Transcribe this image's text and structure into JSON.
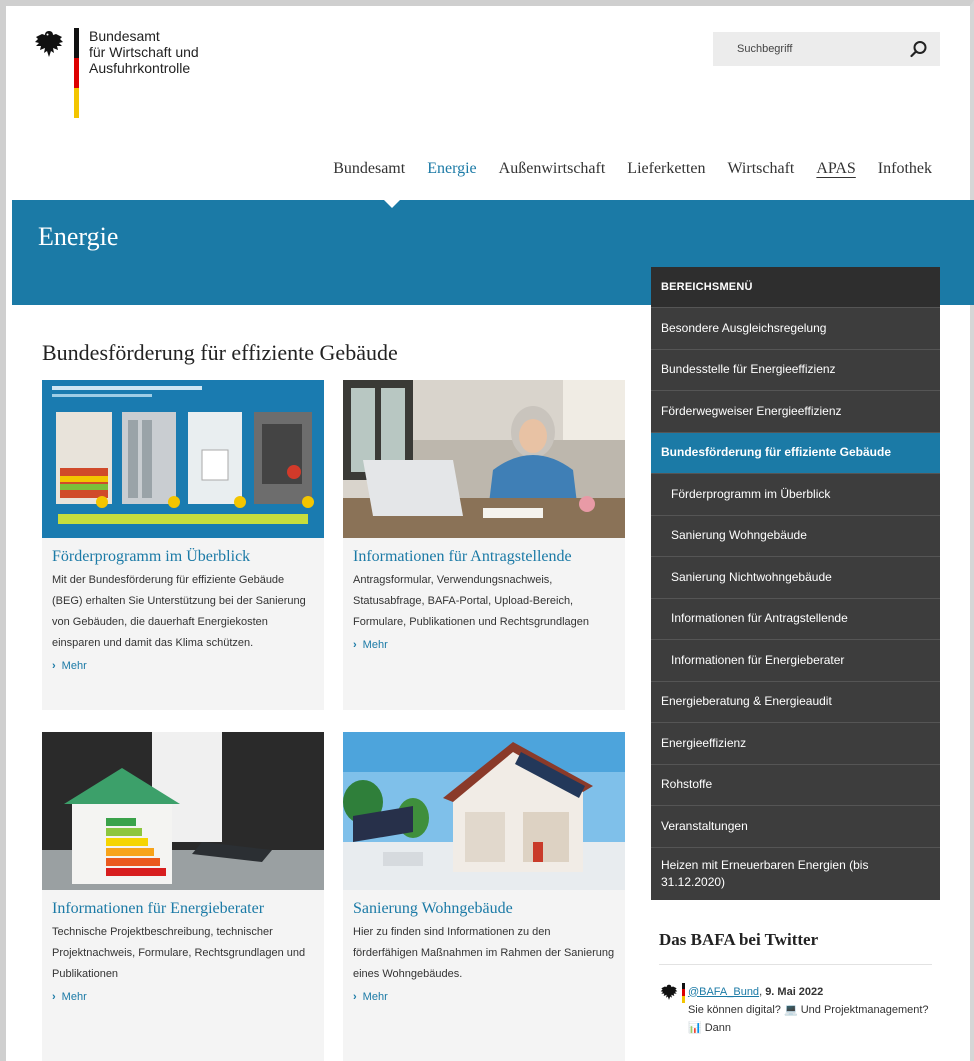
{
  "header": {
    "logo_line1": "Bundesamt",
    "logo_line2": "für Wirtschaft und",
    "logo_line3": "Ausfuhrkontrolle",
    "search_placeholder": "Suchbegriff"
  },
  "nav": {
    "items": [
      "Bundesamt",
      "Energie",
      "Außenwirtschaft",
      "Lieferketten",
      "Wirtschaft",
      "APAS",
      "Infothek"
    ],
    "active": "Energie"
  },
  "banner": {
    "title": "Energie"
  },
  "main": {
    "title": "Bundesförderung für effiziente Gebäude",
    "cards": [
      {
        "title": "Förderprogramm im Überblick",
        "text": "Mit der Bundesförderung für effiziente Gebäude (BEG) erhalten Sie Unterstützung bei der Sanierung von Gebäuden, die dauerhaft Energiekosten einsparen und damit das Klima schützen.",
        "more": "Mehr"
      },
      {
        "title": "Informationen für Antragstellende",
        "text": "Antragsformular, Verwendungsnachweis, Statusabfrage, BAFA-Portal, Upload-Bereich, Formulare, Publikationen und Rechtsgrundlagen",
        "more": "Mehr"
      },
      {
        "title": "Informationen für Energieberater",
        "text": "Technische Projektbeschreibung, technischer Projektnachweis, Formulare, Rechtsgrundlagen und Publikationen",
        "more": "Mehr"
      },
      {
        "title": "Sanierung Wohngebäude",
        "text": "Hier zu finden sind Informationen zu den förderfähigen Maßnahmen im Rahmen der Sanierung eines Wohngebäudes.",
        "more": "Mehr"
      }
    ]
  },
  "sidebar": {
    "header": "BEREICHSMENÜ",
    "items": [
      {
        "label": "Besondere Ausgleichsregelung",
        "level": 0
      },
      {
        "label": "Bundesstelle für Energieeffizienz",
        "level": 0
      },
      {
        "label": "Förderwegweiser Energieeffizienz",
        "level": 0
      },
      {
        "label": "Bundesförderung für effiziente Gebäude",
        "level": 0,
        "active": true
      },
      {
        "label": "Förderprogramm im Überblick",
        "level": 1
      },
      {
        "label": "Sanierung Wohngebäude",
        "level": 1
      },
      {
        "label": "Sanierung Nichtwohngebäude",
        "level": 1
      },
      {
        "label": "Informationen für Antragstellende",
        "level": 1
      },
      {
        "label": "Informationen für Energieberater",
        "level": 1
      },
      {
        "label": "Energieberatung & Energieaudit",
        "level": 0
      },
      {
        "label": "Energieeffizienz",
        "level": 0
      },
      {
        "label": "Rohstoffe",
        "level": 0
      },
      {
        "label": "Veranstaltungen",
        "level": 0
      },
      {
        "label": "Heizen mit Erneuerbaren Energien (bis 31.12.2020)",
        "level": 0
      }
    ]
  },
  "twitter": {
    "title": "Das BAFA bei Twitter",
    "handle": "@BAFA_Bund",
    "date": "9. Mai 2022",
    "text": "Sie können digital? 💻 Und Projektmanagement? 📊 Dann"
  },
  "colors": {
    "accent": "#1b7aa6",
    "sidebar_bg": "#3d3d3d",
    "sidebar_header": "#2e2e2e"
  }
}
